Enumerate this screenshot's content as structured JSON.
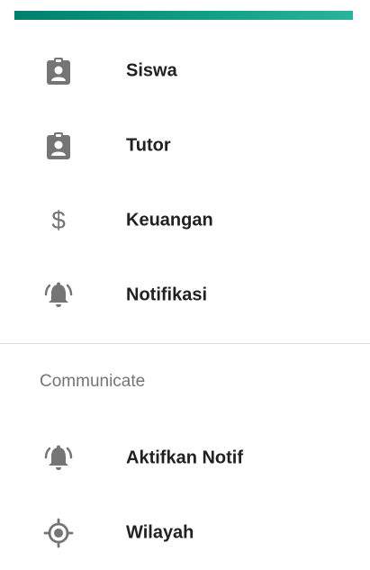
{
  "menu": {
    "items": [
      {
        "label": "Siswa",
        "icon": "clipboard-account-icon"
      },
      {
        "label": "Tutor",
        "icon": "clipboard-account-icon"
      },
      {
        "label": "Keuangan",
        "icon": "dollar-icon",
        "glyph": "$"
      },
      {
        "label": "Notifikasi",
        "icon": "bell-ring-icon"
      }
    ]
  },
  "communicate": {
    "header": "Communicate",
    "items": [
      {
        "label": "Aktifkan Notif",
        "icon": "bell-ring-icon"
      },
      {
        "label": "Wilayah",
        "icon": "gps-target-icon"
      }
    ]
  },
  "colors": {
    "accent": "#00806f",
    "icon": "#757575",
    "text": "#212121",
    "divider": "#dcdcdc"
  }
}
